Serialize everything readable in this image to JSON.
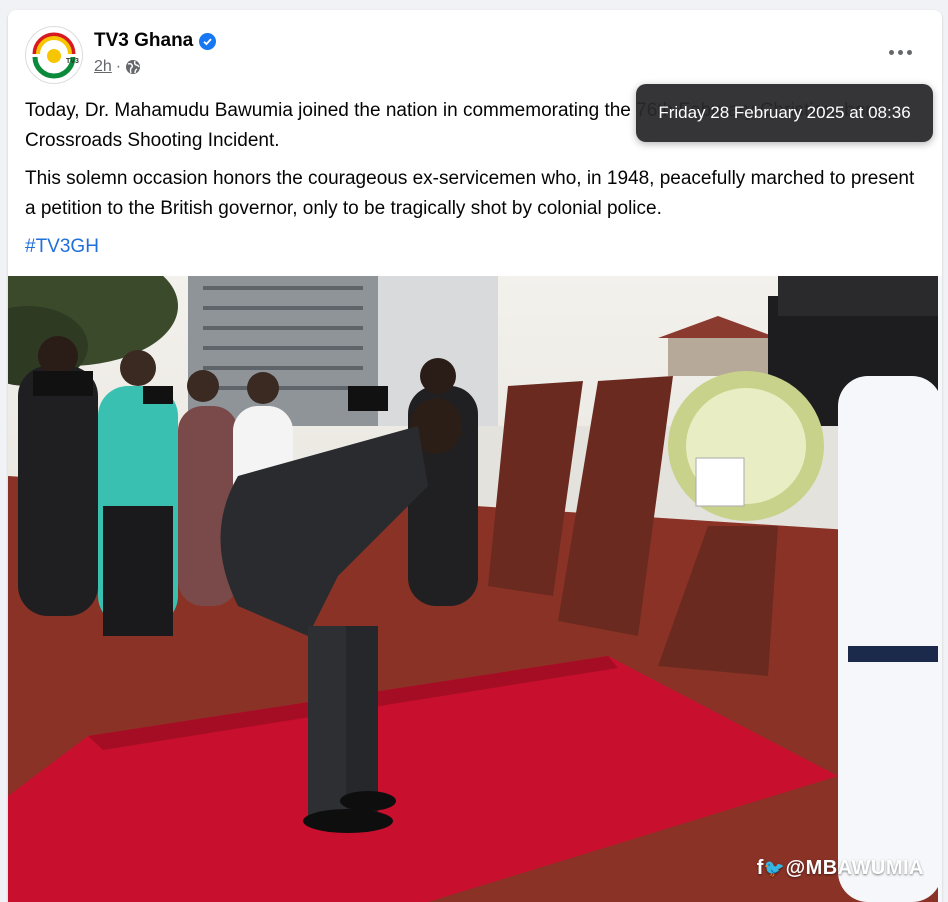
{
  "post": {
    "page_name": "TV3 Ghana",
    "avatar_logo_text": "TV3",
    "time": "2h",
    "separator": "·",
    "audience_icon": "globe-icon",
    "verified_icon": "verified-badge-icon",
    "more_icon": "more-options-icon",
    "paragraph1": "Today, Dr. Mahamudu Bawumia joined the nation in commemorating the 76th February Christiansborg Crossroads Shooting Incident.",
    "paragraph2": "This solemn occasion honors the courageous ex-servicemen who, in 1948, peacefully marched to present a petition to the British governor, only to be tragically shot by colonial police.",
    "hashtag": "#TV3GH"
  },
  "tooltip": {
    "text": "Friday 28 February 2025 at 08:36"
  },
  "photo": {
    "watermark": "f🐦@MBAWUMIA",
    "watermark_text": "@MBAWUMIA",
    "wreath_card": "",
    "colors": {
      "carpet": "#c8102e",
      "sky": "#e9e8e4",
      "suit": "#2a2b2e",
      "podium": "#6b2a1f"
    }
  },
  "colors": {
    "link": "#216fdb",
    "verified": "#1877f2",
    "muted": "#65676b",
    "tooltip_bg": "#28282a"
  }
}
